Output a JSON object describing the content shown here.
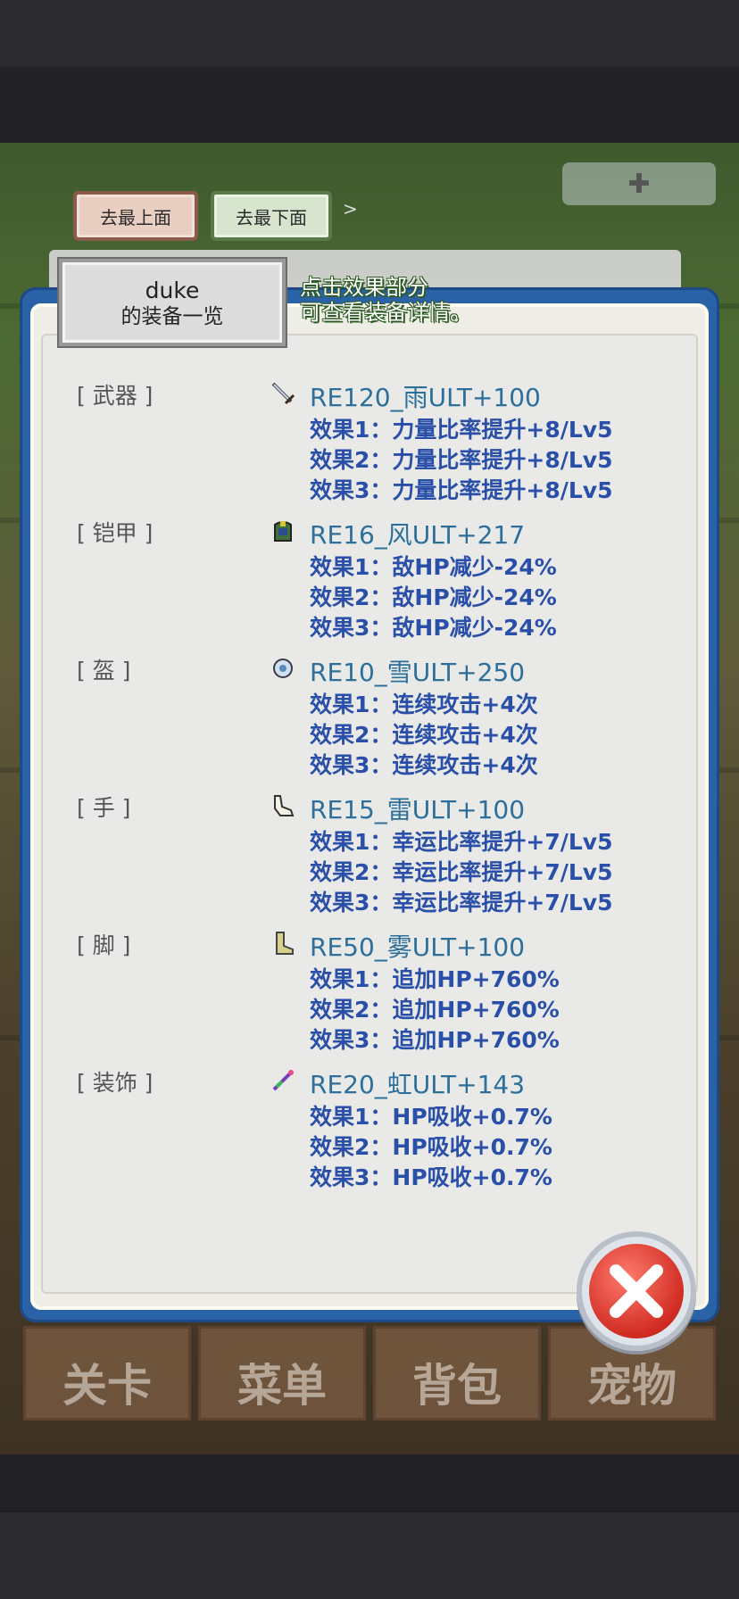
{
  "top_buttons": {
    "to_top": "去最上面",
    "to_bottom": "去最下面",
    "arrow": ">"
  },
  "player": {
    "name": "duke",
    "title": "的装备一览"
  },
  "hint": {
    "line1": "点击效果部分",
    "line2": "可查看装备详情。"
  },
  "equipment": [
    {
      "slot": "[ 武器 ]",
      "icon": "sword-icon",
      "name": "RE120_雨ULT+100",
      "effects": [
        "效果1：力量比率提升+8/Lv5",
        "效果2：力量比率提升+8/Lv5",
        "效果3：力量比率提升+8/Lv5"
      ]
    },
    {
      "slot": "[ 铠甲 ]",
      "icon": "armor-icon",
      "name": "RE16_风ULT+217",
      "effects": [
        "效果1：敌HP减少-24%",
        "效果2：敌HP减少-24%",
        "效果3：敌HP减少-24%"
      ]
    },
    {
      "slot": "[ 盔 ]",
      "icon": "helmet-icon",
      "name": "RE10_雪ULT+250",
      "effects": [
        "效果1：连续攻击+4次",
        "效果2：连续攻击+4次",
        "效果3：连续攻击+4次"
      ]
    },
    {
      "slot": "[ 手 ]",
      "icon": "glove-icon",
      "name": "RE15_雷ULT+100",
      "effects": [
        "效果1：幸运比率提升+7/Lv5",
        "效果2：幸运比率提升+7/Lv5",
        "效果3：幸运比率提升+7/Lv5"
      ]
    },
    {
      "slot": "[ 脚 ]",
      "icon": "boot-icon",
      "name": "RE50_雾ULT+100",
      "effects": [
        "效果1：追加HP+760%",
        "效果2：追加HP+760%",
        "效果3：追加HP+760%"
      ]
    },
    {
      "slot": "[ 装饰 ]",
      "icon": "accessory-icon",
      "name": "RE20_虹ULT+143",
      "effects": [
        "效果1：HP吸收+0.7%",
        "效果2：HP吸收+0.7%",
        "效果3：HP吸收+0.7%"
      ]
    }
  ],
  "bottom_tabs": [
    "关卡",
    "菜单",
    "背包",
    "宠物"
  ],
  "colors": {
    "panel_border": "#2a62a8",
    "item_name": "#2c6f9a",
    "effect_text": "#2a4fa8",
    "close": "#d12c22"
  }
}
